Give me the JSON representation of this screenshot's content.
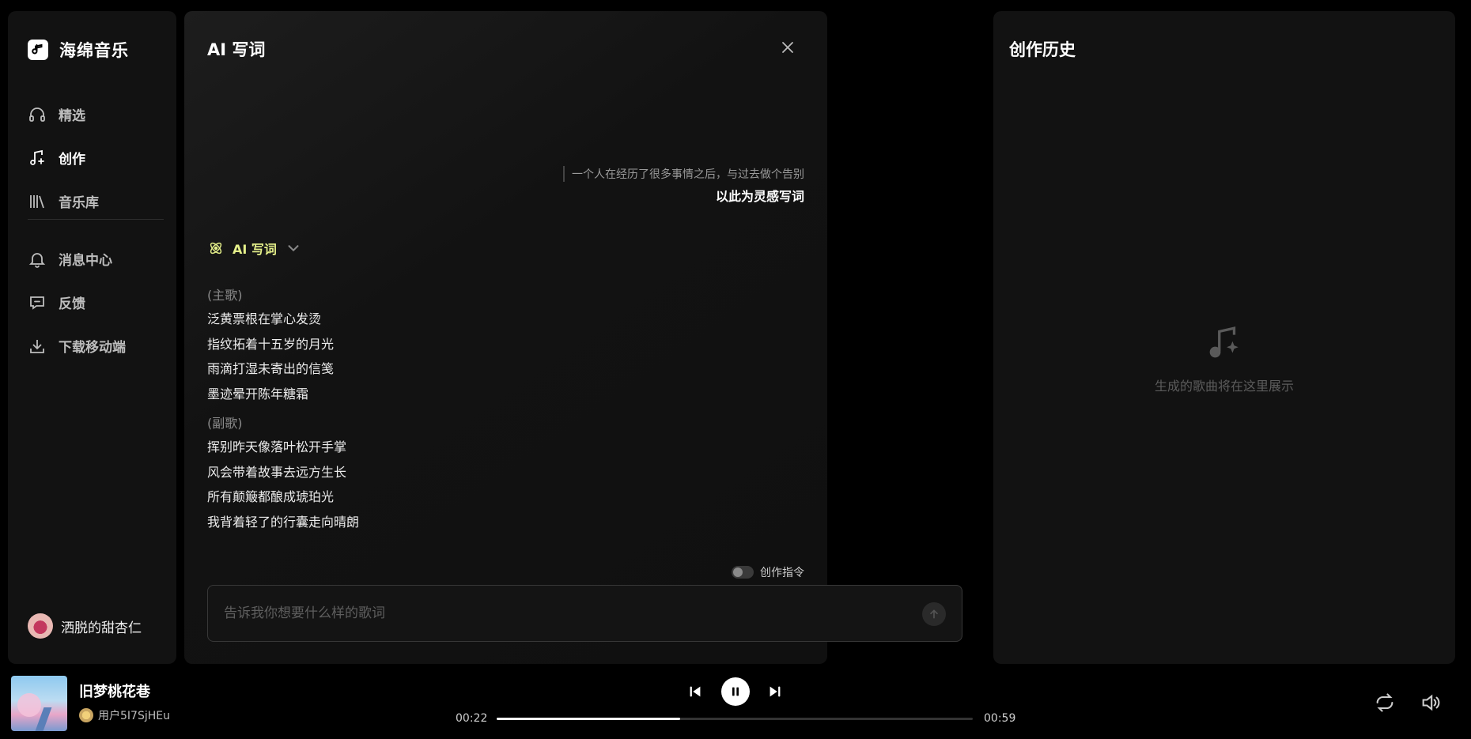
{
  "app": {
    "name": "海绵音乐"
  },
  "sidebar": {
    "nav_top": [
      {
        "label": "精选",
        "icon": "headphones-icon",
        "active": false
      },
      {
        "label": "创作",
        "icon": "music-sparkle-icon",
        "active": true
      },
      {
        "label": "音乐库",
        "icon": "library-icon",
        "active": false
      }
    ],
    "nav_bottom": [
      {
        "label": "消息中心",
        "icon": "bell-icon"
      },
      {
        "label": "反馈",
        "icon": "feedback-icon"
      },
      {
        "label": "下载移动端",
        "icon": "download-icon"
      }
    ],
    "user_name": "洒脱的甜杏仁"
  },
  "editor": {
    "title": "AI 写词",
    "prompt_quote": "一个人在经历了很多事情之后，与过去做个告别",
    "prompt_action": "以此为灵感写词",
    "mode_label": "AI 写词",
    "sections": [
      {
        "label": "(主歌)",
        "lines": [
          "泛黄票根在掌心发烫",
          "指纹拓着十五岁的月光",
          "雨滴打湿未寄出的信笺",
          "墨迹晕开陈年糖霜"
        ]
      },
      {
        "label": "(副歌)",
        "lines": [
          "挥别昨天像落叶松开手掌",
          "风会带着故事去远方生长",
          "所有颠簸都酿成琥珀光",
          "我背着轻了的行囊走向晴朗"
        ]
      }
    ],
    "toggle_label": "创作指令",
    "toggle_on": false,
    "input_placeholder": "告诉我你想要什么样的歌词",
    "input_value": ""
  },
  "history": {
    "title": "创作历史",
    "empty_text": "生成的歌曲将在这里展示"
  },
  "player": {
    "song_title": "旧梦桃花巷",
    "artist": "用户5I7SjHEu",
    "current_time": "00:22",
    "total_time": "00:59",
    "progress": 0.385,
    "playing": true
  },
  "colors": {
    "accent": "#e5f08a",
    "panel": "#121212",
    "background": "#000000"
  }
}
